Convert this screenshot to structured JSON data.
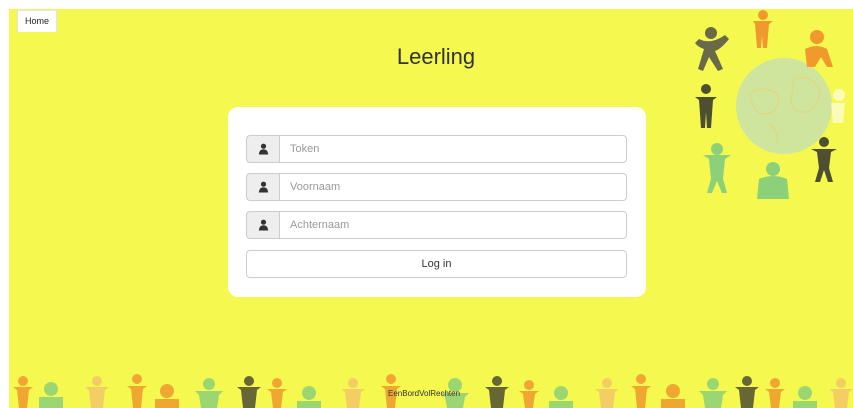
{
  "nav": {
    "home_label": "Home"
  },
  "page_title": "Leerling",
  "form": {
    "token": {
      "placeholder": "Token",
      "value": ""
    },
    "first_name": {
      "placeholder": "Voornaam",
      "value": ""
    },
    "last_name": {
      "placeholder": "Achternaam",
      "value": ""
    },
    "login_label": "Log in",
    "field_icon": "user-icon"
  },
  "footer": {
    "brand_text": "EenBordVolRechten"
  },
  "colors": {
    "background": "#f4f84f",
    "panel": "#ffffff",
    "globe": "#c7e39a",
    "figure_orange": "#f09a2e",
    "figure_green": "#8cd17a",
    "figure_dark": "#4a4a2a"
  },
  "decoration": {
    "globe_illustration": "globe-with-children-icon",
    "footer_illustration": "children-row-icon"
  }
}
